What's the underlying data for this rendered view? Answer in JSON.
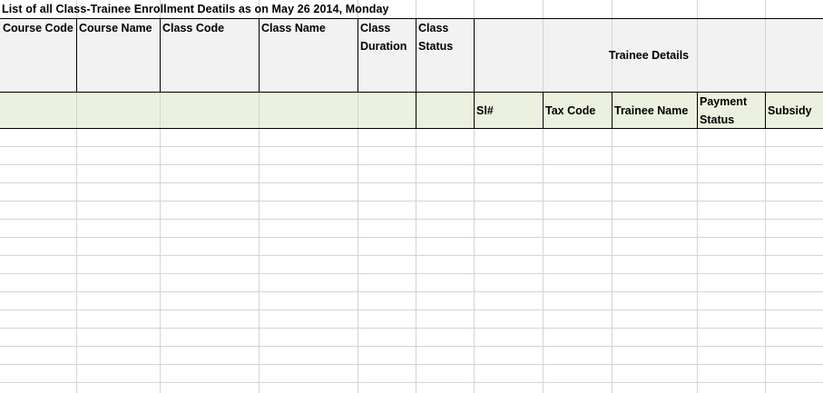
{
  "sheet": {
    "title": "List of all Class-Trainee Enrollment Deatils as on May 26 2014, Monday",
    "class_headers": [
      {
        "key": "course_code",
        "label": "Course Code"
      },
      {
        "key": "course_name",
        "label": "Course Name"
      },
      {
        "key": "class_code",
        "label": "Class Code"
      },
      {
        "key": "class_name",
        "label": "Class Name"
      },
      {
        "key": "class_duration",
        "label": "Class Duration"
      },
      {
        "key": "class_status",
        "label": "Class Status"
      }
    ],
    "trainee_group_label": "Trainee Details",
    "trainee_headers": [
      {
        "key": "sl",
        "label": "Sl#"
      },
      {
        "key": "tax_code",
        "label": "Tax Code"
      },
      {
        "key": "trainee_name",
        "label": "Trainee Name"
      },
      {
        "key": "payment_status",
        "label": "Payment Status"
      },
      {
        "key": "subsidy",
        "label": "Subsidy"
      }
    ],
    "colors": {
      "header_fill": "#f2f2f2",
      "subheader_fill": "#ebf1de",
      "gridline": "#d4d4d4",
      "border": "#000000"
    }
  }
}
